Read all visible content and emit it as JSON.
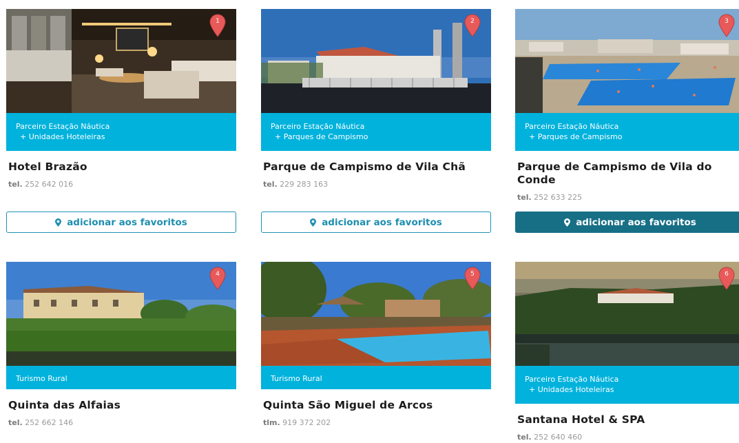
{
  "colors": {
    "accent": "#00b2dc",
    "button": "#1d8fb0",
    "button_active": "#176f86",
    "pin": "#e85a5a"
  },
  "cards": [
    {
      "pin": "1",
      "category": [
        "Parceiro Estação Náutica",
        "+ Unidades Hoteleiras"
      ],
      "name": "Hotel Brazão",
      "phone_label": "tel.",
      "phone": "252 642 016",
      "fav": "adicionar aos favoritos"
    },
    {
      "pin": "2",
      "category": [
        "Parceiro Estação Náutica",
        "+ Parques de Campismo"
      ],
      "name": "Parque de Campismo de Vila Chã",
      "phone_label": "tel.",
      "phone": "229 283 163",
      "fav": "adicionar aos favoritos"
    },
    {
      "pin": "3",
      "category": [
        "Parceiro Estação Náutica",
        "+ Parques de Campismo"
      ],
      "name": "Parque de Campismo de Vila do Conde",
      "phone_label": "tel.",
      "phone": "252 633 225",
      "fav": "adicionar aos favoritos"
    },
    {
      "pin": "4",
      "category": [
        "Turismo Rural"
      ],
      "name": "Quinta das Alfaias",
      "phone_label": "tel.",
      "phone": "252 662 146"
    },
    {
      "pin": "5",
      "category": [
        "Turismo Rural"
      ],
      "name": "Quinta São Miguel de Arcos",
      "phone_label": "tlm.",
      "phone": "919 372 202"
    },
    {
      "pin": "6",
      "category": [
        "Parceiro Estação Náutica",
        "+ Unidades Hoteleiras"
      ],
      "name": "Santana Hotel & SPA",
      "phone_label": "tel.",
      "phone": "252 640 460"
    }
  ]
}
